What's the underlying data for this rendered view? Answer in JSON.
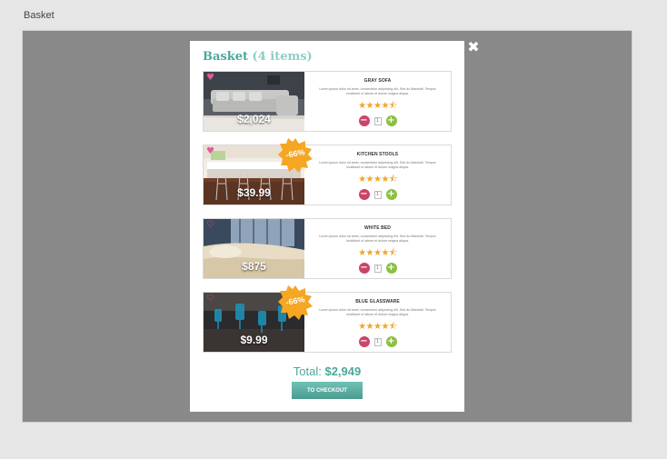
{
  "window": {
    "title": "Basket"
  },
  "modal": {
    "title": "Basket",
    "count_label": "(4 items)",
    "close_icon": "close-icon",
    "items": [
      {
        "name": "GRAY SOFA",
        "price": "$2,024",
        "discount": "",
        "description": "Lorem ipsum dolor sit amet, consectetur adipiscing elit. Sed do Marshall. Tempor incididunt ut labore et dolore magna aliqua.",
        "rating": 4.5,
        "stars": "★★★★⯪",
        "quantity": "1",
        "image": "gray sofa"
      },
      {
        "name": "KITCHEN STOOLS",
        "price": "$39.99",
        "discount": "-66%",
        "description": "Lorem ipsum dolor sit amet, consectetur adipiscing elit. Sed do Marshall. Tempor incididunt ut labore et dolore magna aliqua.",
        "rating": 4.5,
        "stars": "★★★★⯪",
        "quantity": "1",
        "image": "kitchen stools"
      },
      {
        "name": "WHITE BED",
        "price": "$875",
        "discount": "",
        "description": "Lorem ipsum dolor sit amet, consectetur adipiscing elit. Sed do Marshall. Tempor incididunt ut labore et dolore magna aliqua.",
        "rating": 4.5,
        "stars": "★★★★⯪",
        "quantity": "1",
        "image": "white bed"
      },
      {
        "name": "BLUE GLASSWARE",
        "price": "$9.99",
        "discount": "-66%",
        "description": "Lorem ipsum dolor sit amet, consectetur adipiscing elit. Sed do Marshall. Tempor incididunt ut labore et dolore magna aliqua.",
        "rating": 4.5,
        "stars": "★★★★⯪",
        "quantity": "1",
        "image": "blue glassware"
      }
    ],
    "total_label": "Total:",
    "total_value": "$2,949",
    "checkout_label": "TO CHECKOUT"
  },
  "colors": {
    "accent": "#4aa89b",
    "minus": "#cc4468",
    "plus": "#8cc043",
    "star": "#f0a52c",
    "badge": "#f5a623"
  }
}
